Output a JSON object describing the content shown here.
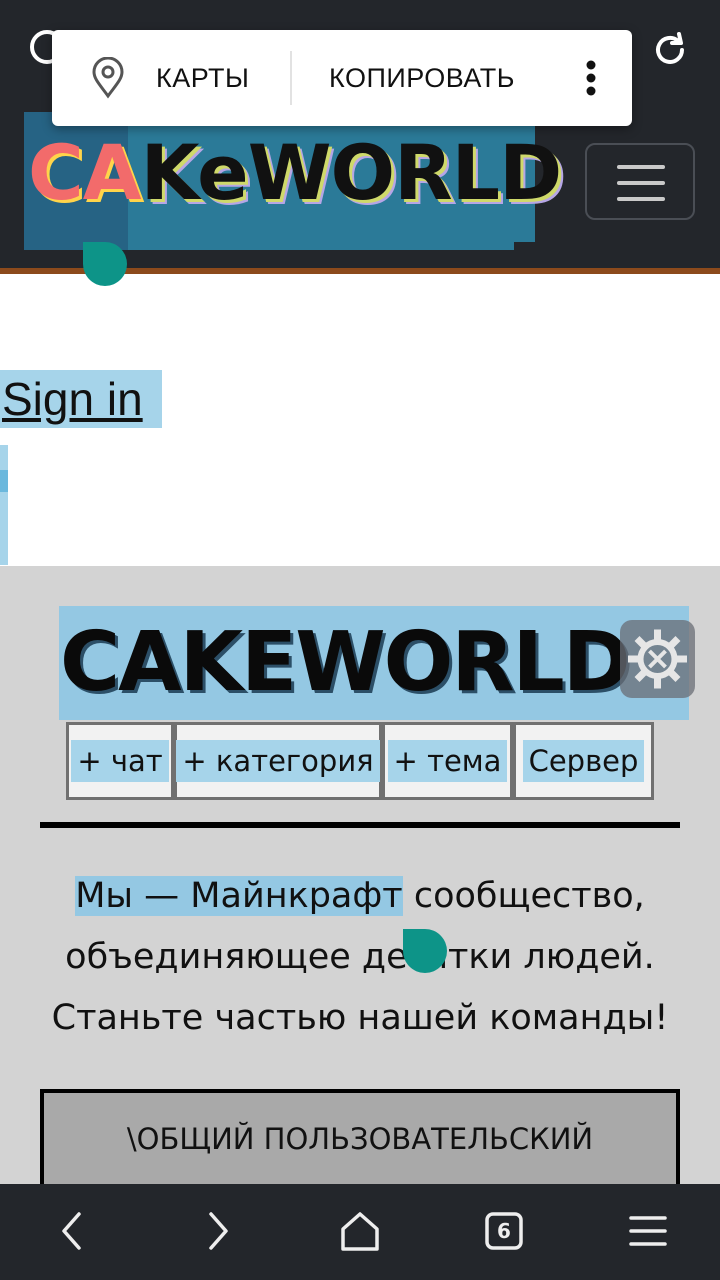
{
  "popup": {
    "maps_label": "КАРТЫ",
    "copy_label": "КОПИРОВАТЬ"
  },
  "header": {
    "logo_part1": "CA",
    "logo_part2": "KeWORLD"
  },
  "signin": {
    "label": "Sign in"
  },
  "main": {
    "site_title": "CAKEWORLD",
    "nav": [
      {
        "label": "+ чат"
      },
      {
        "label": "+ категория"
      },
      {
        "label": "+ тема"
      },
      {
        "label": "Сервер"
      }
    ],
    "desc_highlight": "Мы — Майнкрафт",
    "desc_rest1": " сообщество,",
    "desc_line2": "объединяющее десятки людей.",
    "desc_line3": "Станьте частью нашей команды!",
    "forum_title": "\\ОБЩИЙ ПОЛЬЗОВАТЕЛЬСКИЙ"
  },
  "bottom_bar": {
    "tabs_count": "6"
  },
  "colors": {
    "header_bg": "#23262b",
    "selection": "#a6d4ea",
    "handle": "#0d9488",
    "content_bg": "#d3d3d3"
  }
}
